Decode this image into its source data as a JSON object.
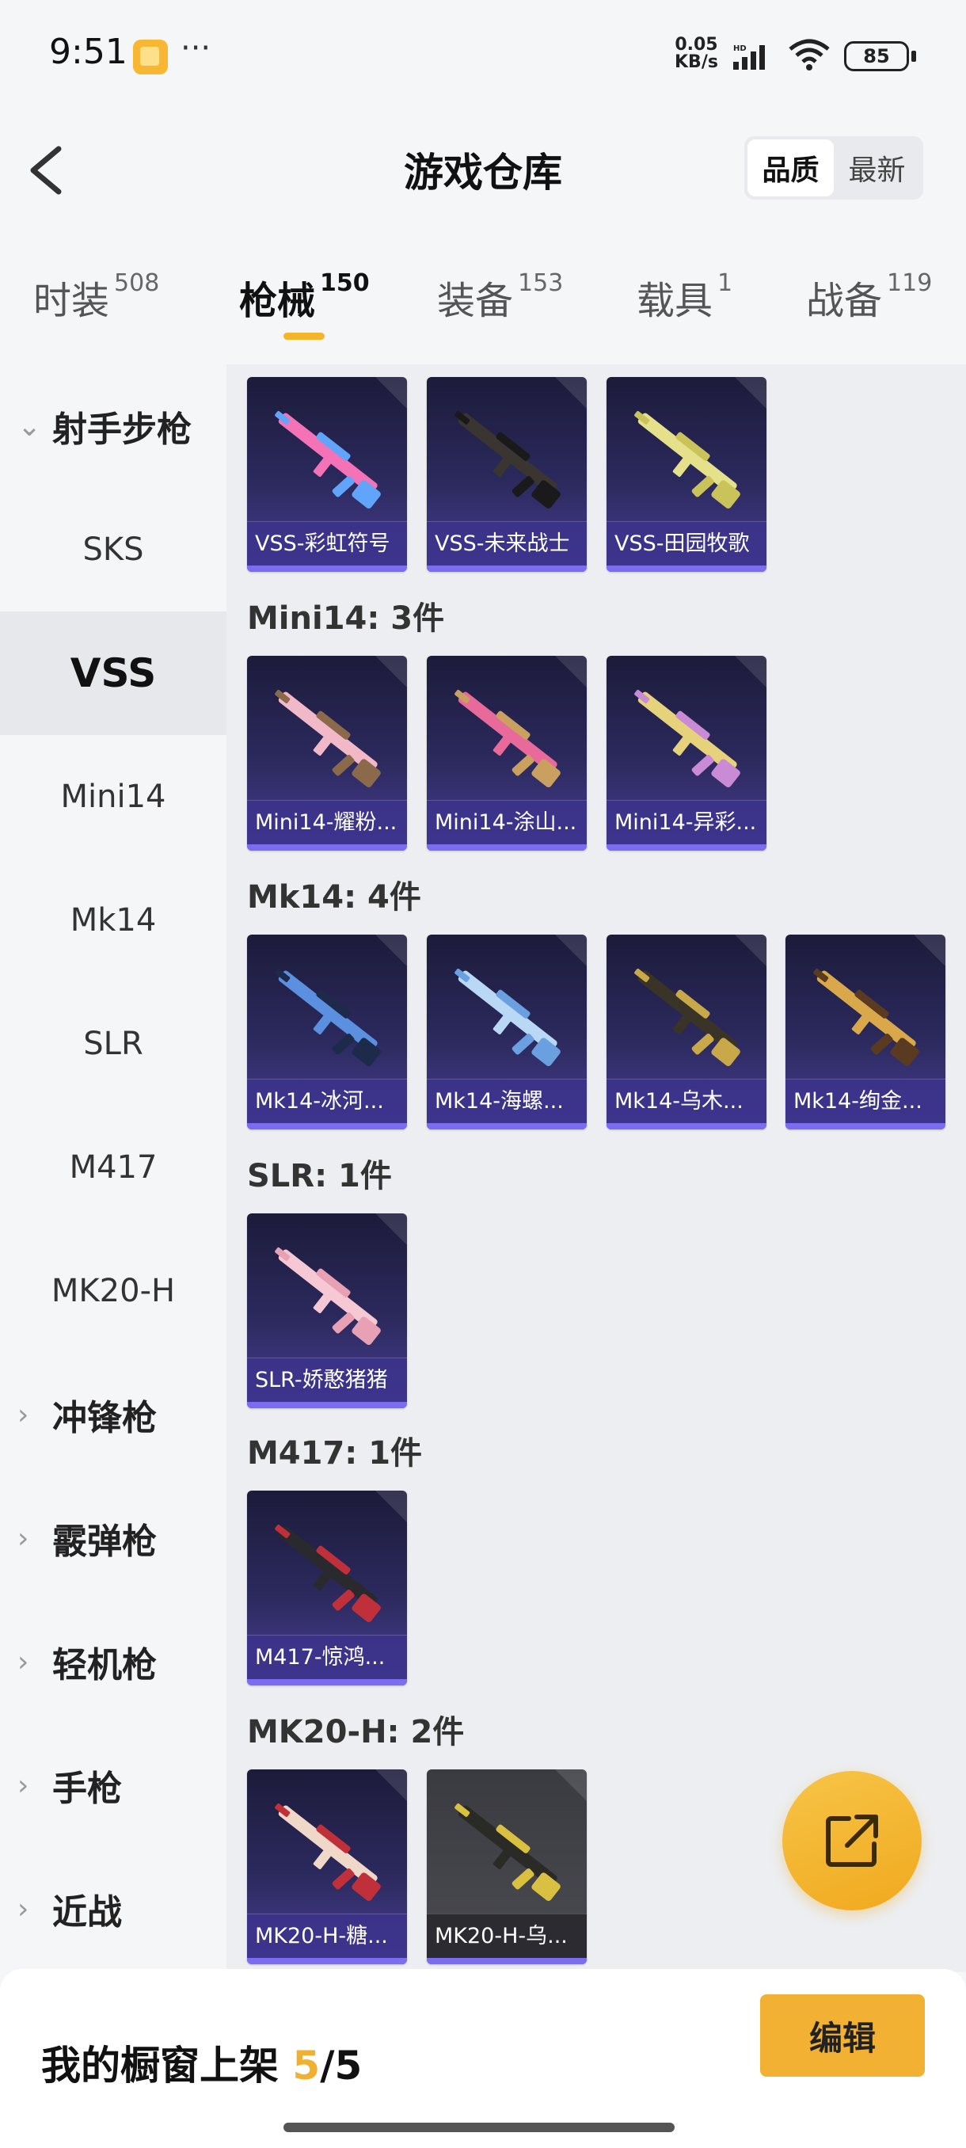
{
  "status": {
    "time": "9:51",
    "dots": "···",
    "net_speed": "0.05",
    "net_unit": "KB/s",
    "battery": "85"
  },
  "header": {
    "title": "游戏仓库",
    "sort_quality": "品质",
    "sort_latest": "最新"
  },
  "tabs": [
    {
      "label": "时装",
      "count": "508"
    },
    {
      "label": "枪械",
      "count": "150"
    },
    {
      "label": "装备",
      "count": "153"
    },
    {
      "label": "载具",
      "count": "1"
    },
    {
      "label": "战备",
      "count": "119"
    }
  ],
  "sidebar": [
    {
      "label": "射手步枪"
    },
    {
      "label": "SKS"
    },
    {
      "label": "VSS"
    },
    {
      "label": "Mini14"
    },
    {
      "label": "Mk14"
    },
    {
      "label": "SLR"
    },
    {
      "label": "M417"
    },
    {
      "label": "MK20-H"
    },
    {
      "label": "冲锋枪"
    },
    {
      "label": "霰弹枪"
    },
    {
      "label": "轻机枪"
    },
    {
      "label": "手枪"
    },
    {
      "label": "近战"
    }
  ],
  "sections": [
    {
      "label": "",
      "items": [
        "VSS-彩虹符号",
        "VSS-未来战士",
        "VSS-田园牧歌"
      ]
    },
    {
      "label": "Mini14: 3件",
      "items": [
        "Mini14-耀粉...",
        "Mini14-涂山...",
        "Mini14-异彩..."
      ]
    },
    {
      "label": "Mk14: 4件",
      "items": [
        "Mk14-冰河...",
        "Mk14-海螺...",
        "Mk14-乌木...",
        "Mk14-绚金..."
      ]
    },
    {
      "label": "SLR: 1件",
      "items": [
        "SLR-娇憨猪猪"
      ]
    },
    {
      "label": "M417: 1件",
      "items": [
        "M417-惊鸿..."
      ]
    },
    {
      "label": "MK20-H: 2件",
      "items": [
        "MK20-H-糖...",
        "MK20-H-乌..."
      ]
    }
  ],
  "bottom": {
    "shelf_label": "我的橱窗上架 ",
    "shelf_current": "5",
    "shelf_total": "/5",
    "edit": "编辑"
  },
  "colors": {
    "accent": "#f2b133",
    "card_bg": "#2c2a5e",
    "card_bar": "#7b6cf0"
  },
  "icons": {
    "back": "chevron-left-icon",
    "share": "external-link-icon",
    "chevron": "chevron-right-icon",
    "expand": "chevron-down-icon"
  }
}
